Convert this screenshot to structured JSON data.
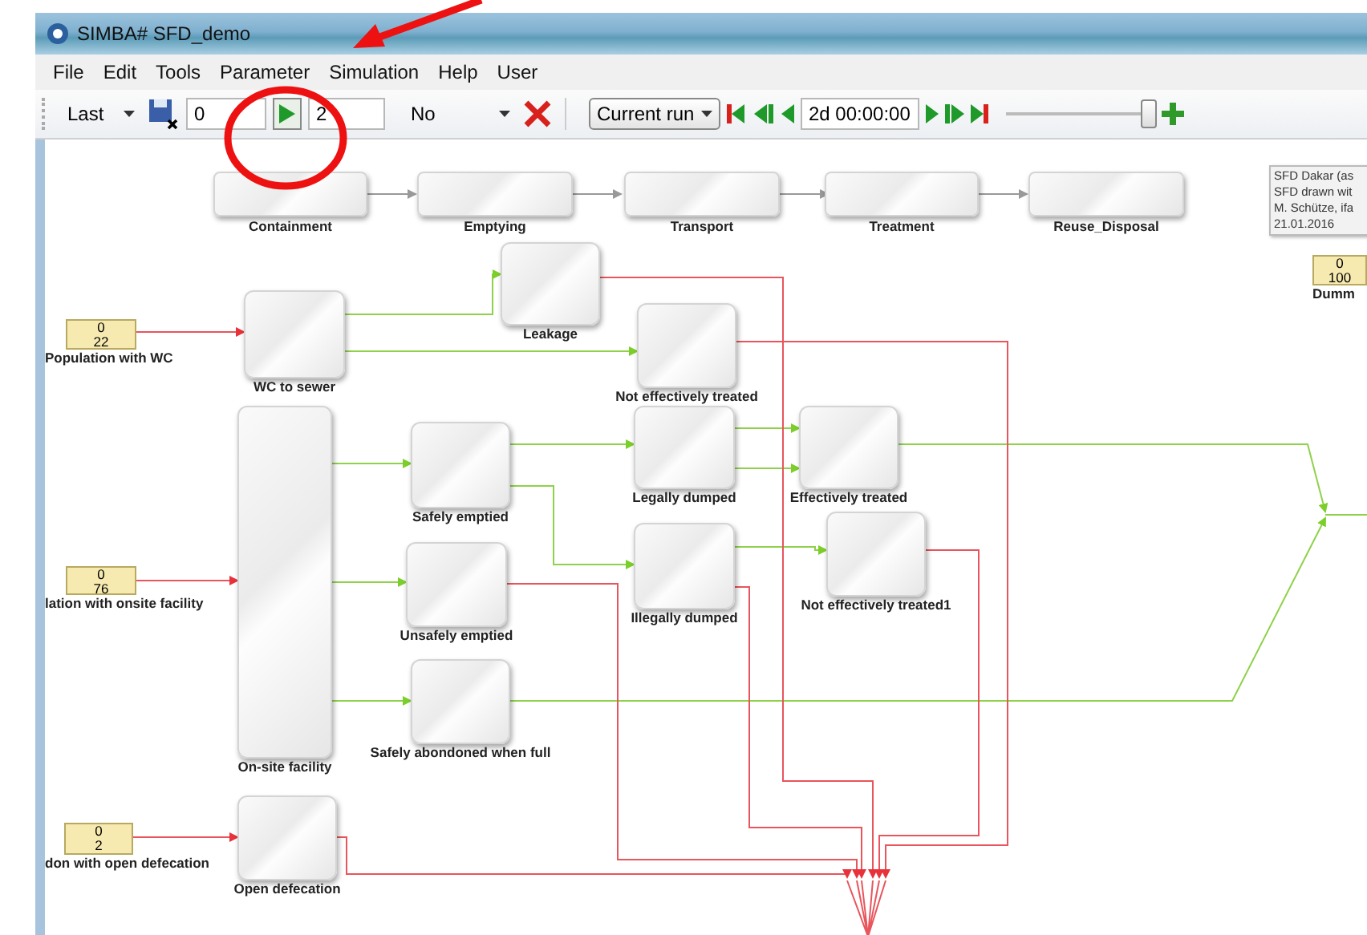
{
  "window": {
    "title": "SIMBA# SFD_demo"
  },
  "menu": [
    "File",
    "Edit",
    "Tools",
    "Parameter",
    "Simulation",
    "Help",
    "User"
  ],
  "toolbar": {
    "mode": "Last",
    "start": "0",
    "end": "2",
    "option": "No",
    "run": "Current run",
    "time": "2d 00:00:00",
    "slider": {
      "level": 0.97
    }
  },
  "stages": [
    "Containment",
    "Emptying",
    "Transport",
    "Treatment",
    "Reuse_Disposal"
  ],
  "info_note": [
    "SFD Dakar (as",
    "SFD drawn wit",
    "M. Schütze, ifa",
    "21.01.2016"
  ],
  "sources": [
    {
      "value": "0",
      "total": "22",
      "label": "Population with WC"
    },
    {
      "value": "0",
      "total": "76",
      "label": "lation with onsite facility"
    },
    {
      "value": "0",
      "total": "2",
      "label": "don with open defecation"
    },
    {
      "value": "0",
      "total": "100",
      "label": "Dumm"
    }
  ],
  "blocks": [
    {
      "label": "WC to sewer"
    },
    {
      "label": "Leakage"
    },
    {
      "label": "Not effectively treated"
    },
    {
      "label": "On-site facility"
    },
    {
      "label": "Safely emptied"
    },
    {
      "label": "Unsafely emptied"
    },
    {
      "label": "Safely abondoned when full"
    },
    {
      "label": "Legally dumped"
    },
    {
      "label": "Illegally dumped"
    },
    {
      "label": "Effectively treated"
    },
    {
      "label": "Not effectively treated1"
    },
    {
      "label": "Open defecation"
    }
  ]
}
